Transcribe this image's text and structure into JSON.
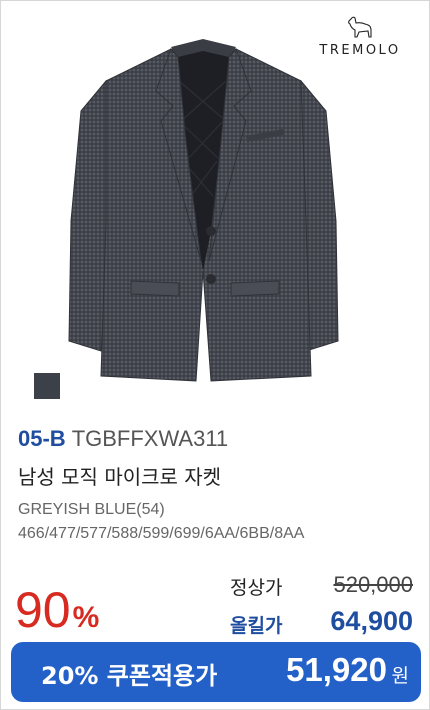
{
  "brand": {
    "name": "TREMOLO",
    "logo_icon": "dog-icon"
  },
  "product": {
    "swatch_color": "#3c4049",
    "code_main": "05-B",
    "code_sub": "TGBFFXWA311",
    "name": "남성 모직 마이크로 자켓",
    "color": "GREYISH BLUE(54)",
    "sizes": "466/477/577/588/599/699/6AA/6BB/8AA"
  },
  "pricing": {
    "discount_value": "90",
    "discount_symbol": "%",
    "regular_label": "정상가",
    "regular_price": "520,000",
    "sale_label": "올킬가",
    "sale_price": "64,900"
  },
  "coupon": {
    "label": "20% 쿠폰적용가",
    "price": "51,920",
    "currency": "원"
  },
  "colors": {
    "accent": "#1f4da0",
    "coupon_bg": "#2361c9",
    "discount": "#d72a20"
  }
}
